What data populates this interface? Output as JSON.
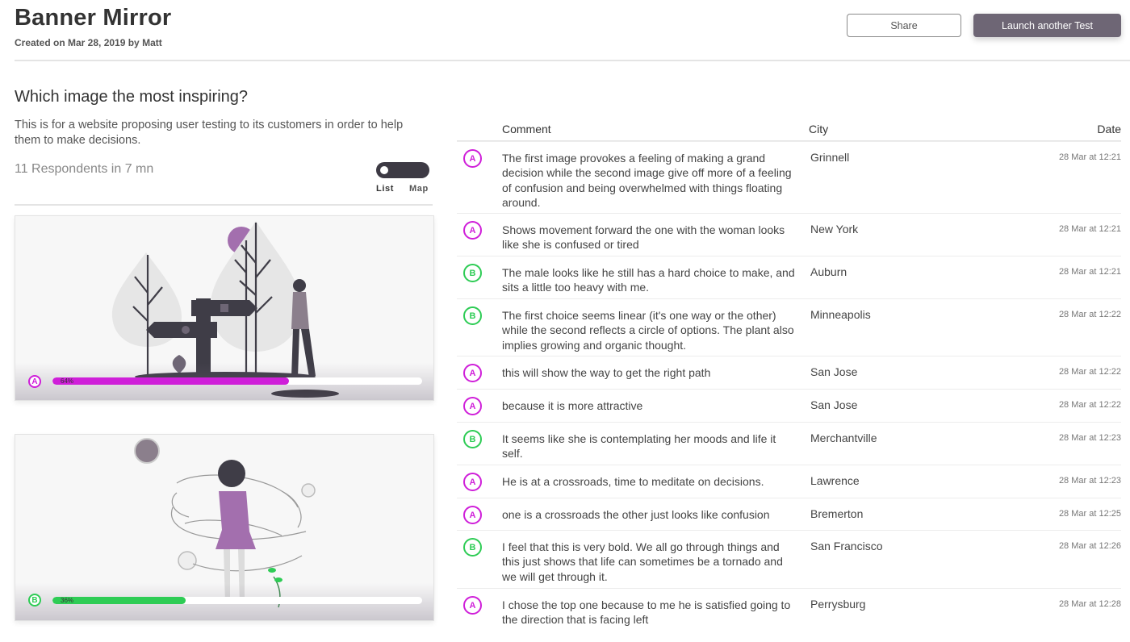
{
  "header": {
    "title": "Banner Mirror",
    "subtitle": "Created on Mar 28, 2019 by Matt",
    "share_label": "Share",
    "launch_label": "Launch another Test"
  },
  "test": {
    "question": "Which image the most inspiring?",
    "description": "This is for a website proposing user testing to its customers in order to help them to make decisions.",
    "respondents": "11 Respondents in 7 mn",
    "view_toggle": {
      "list_label": "List",
      "map_label": "Map",
      "selected": "List"
    }
  },
  "options": [
    {
      "letter": "A",
      "percent_label": "64%",
      "percent": 64,
      "color": "#cf1fd9"
    },
    {
      "letter": "B",
      "percent_label": "36%",
      "percent": 36,
      "color": "#2ecc55"
    }
  ],
  "table": {
    "headers": {
      "comment": "Comment",
      "city": "City",
      "date": "Date"
    },
    "rows": [
      {
        "choice": "A",
        "comment": "The first image provokes a feeling of making a grand decision while the second image give off more of a feeling of confusion and being overwhelmed with things floating around.",
        "city": "Grinnell",
        "date": "28 Mar at 12:21"
      },
      {
        "choice": "A",
        "comment": "Shows movement forward the one with the woman looks like she is confused or tired",
        "city": "New York",
        "date": "28 Mar at 12:21"
      },
      {
        "choice": "B",
        "comment": "The male looks like he still has a hard choice to make, and sits a little too heavy with me.",
        "city": "Auburn",
        "date": "28 Mar at 12:21"
      },
      {
        "choice": "B",
        "comment": "The first choice seems linear (it's one way or the other) while the second reflects a circle of options. The plant also implies growing and organic thought.",
        "city": "Minneapolis",
        "date": "28 Mar at 12:22"
      },
      {
        "choice": "A",
        "comment": "this will show the way to get the right path",
        "city": "San Jose",
        "date": "28 Mar at 12:22"
      },
      {
        "choice": "A",
        "comment": "because it is more attractive",
        "city": "San Jose",
        "date": "28 Mar at 12:22"
      },
      {
        "choice": "B",
        "comment": "It seems like she is contemplating her moods and life it self.",
        "city": "Merchantville",
        "date": "28 Mar at 12:23"
      },
      {
        "choice": "A",
        "comment": "He is at a crossroads, time to meditate on decisions.",
        "city": "Lawrence",
        "date": "28 Mar at 12:23"
      },
      {
        "choice": "A",
        "comment": "one is a crossroads the other just looks like confusion",
        "city": "Bremerton",
        "date": "28 Mar at 12:25"
      },
      {
        "choice": "B",
        "comment": "I feel that this is very bold. We all go through things and this just shows that life can sometimes be a tornado and we will get through it.",
        "city": "San Francisco",
        "date": "28 Mar at 12:26"
      },
      {
        "choice": "A",
        "comment": "I chose the top one because to me he is satisfied going to the direction that is facing left",
        "city": "Perrysburg",
        "date": "28 Mar at 12:28"
      }
    ]
  }
}
